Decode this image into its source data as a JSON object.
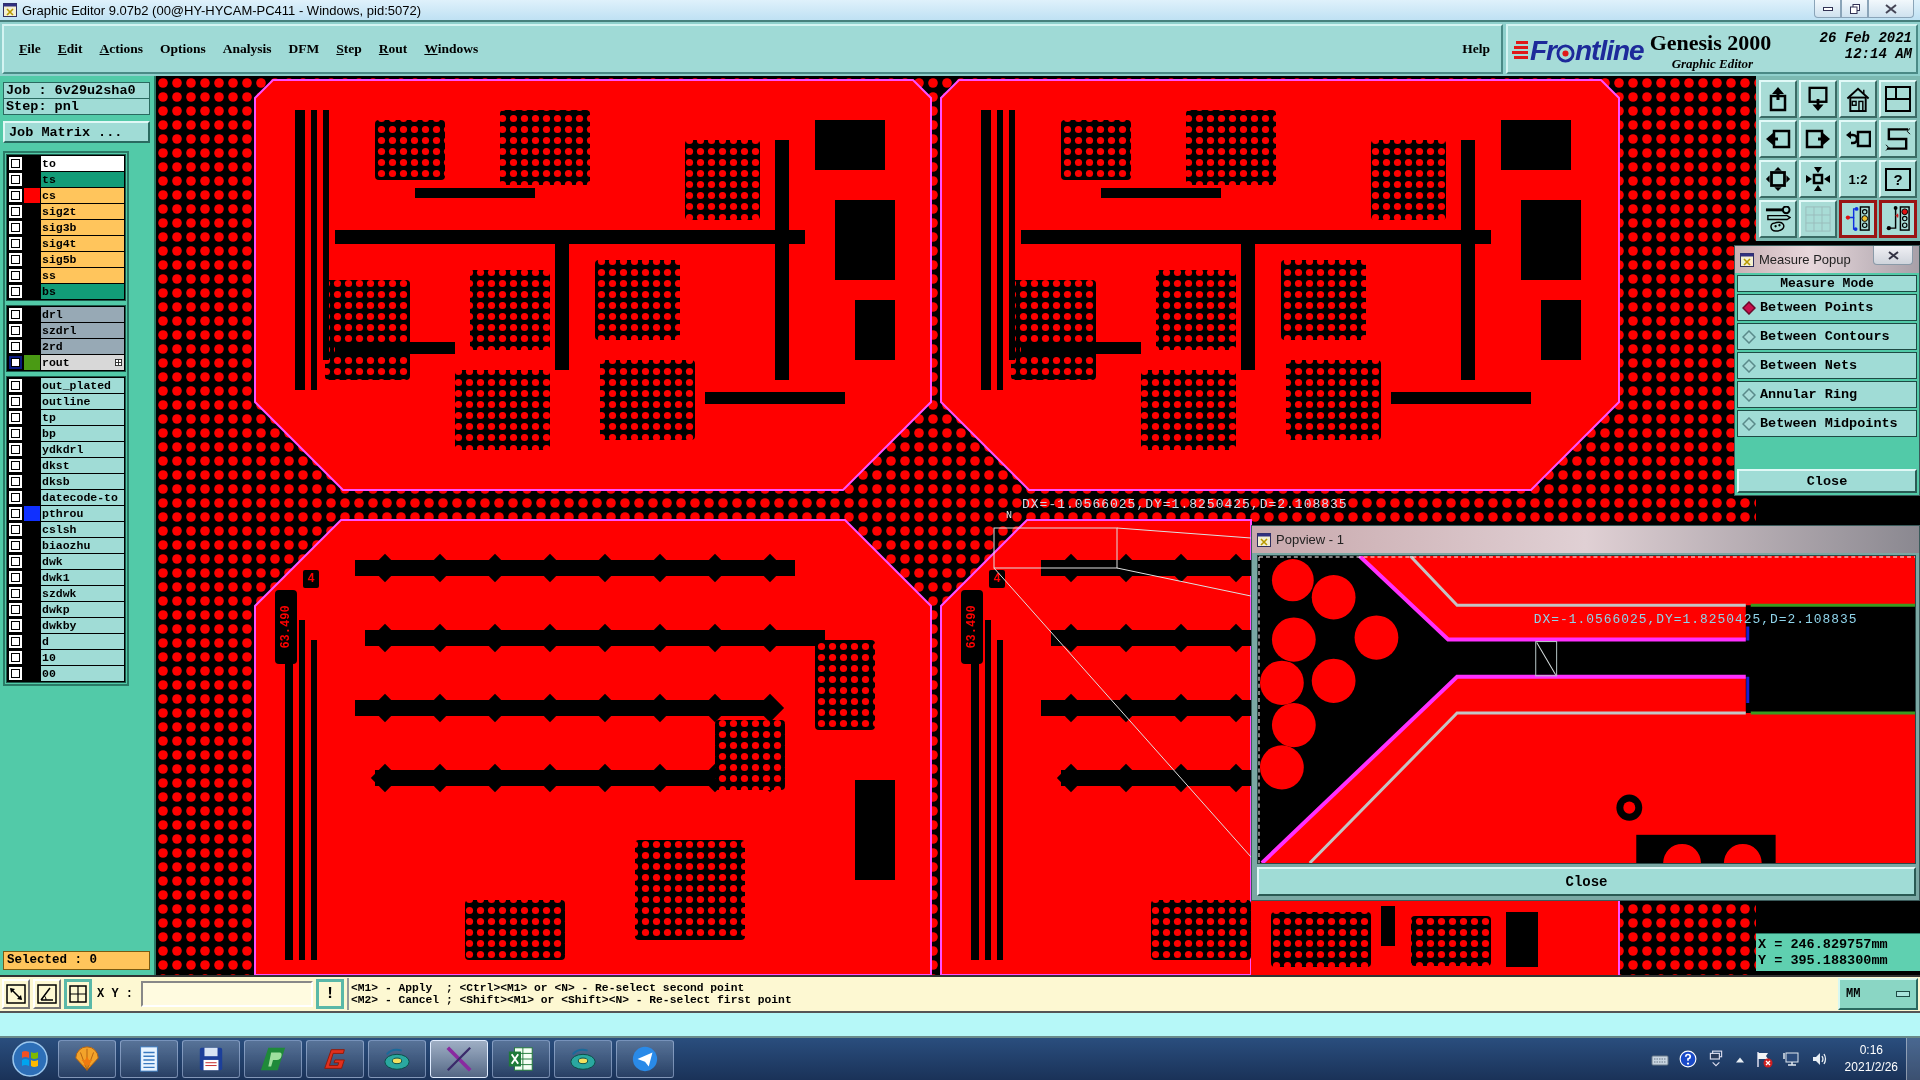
{
  "window": {
    "title": "Graphic Editor 9.07b2 (00@HY-HYCAM-PC411 - Windows, pid:5072)"
  },
  "menu": [
    {
      "label": "File",
      "mnemonic": true
    },
    {
      "label": "Edit",
      "mnemonic": true
    },
    {
      "label": "Actions",
      "mnemonic": true
    },
    {
      "label": "Options",
      "mnemonic": false
    },
    {
      "label": "Analysis",
      "mnemonic": false
    },
    {
      "label": "DFM",
      "mnemonic": false
    },
    {
      "label": "Step",
      "mnemonic": true
    },
    {
      "label": "Rout",
      "mnemonic": true
    },
    {
      "label": "Windows",
      "mnemonic": true
    }
  ],
  "help_menu": {
    "label": "Help",
    "mnemonic": false
  },
  "brand": {
    "logo_parts": [
      "Fr",
      "ntline"
    ],
    "product": "Genesis 2000",
    "subtitle": "Graphic Editor",
    "date": "26 Feb 2021",
    "time": "12:14 AM"
  },
  "job_panel": {
    "job": "Job : 6v29u2sha0",
    "step": "Step: pnl",
    "matrix_button": "Job Matrix ...",
    "selected_count": "Selected : 0"
  },
  "layer_groups": [
    {
      "layers": [
        {
          "name": "to",
          "kind": "silk",
          "checked": false,
          "selected": false
        },
        {
          "name": "ts",
          "kind": "mask",
          "checked": false,
          "selected": false
        },
        {
          "name": "cs",
          "kind": "signal",
          "checked": false,
          "selected": false,
          "color": "#ff0000"
        },
        {
          "name": "sig2t",
          "kind": "signal",
          "checked": false,
          "selected": false
        },
        {
          "name": "sig3b",
          "kind": "signal",
          "checked": false,
          "selected": false
        },
        {
          "name": "sig4t",
          "kind": "signal",
          "checked": false,
          "selected": false
        },
        {
          "name": "sig5b",
          "kind": "signal",
          "checked": false,
          "selected": false
        },
        {
          "name": "ss",
          "kind": "signal",
          "checked": false,
          "selected": false
        },
        {
          "name": "bs",
          "kind": "mask",
          "checked": false,
          "selected": false
        }
      ]
    },
    {
      "layers": [
        {
          "name": "drl",
          "kind": "drill",
          "checked": false,
          "selected": false
        },
        {
          "name": "szdrl",
          "kind": "drill",
          "checked": false,
          "selected": false
        },
        {
          "name": "2rd",
          "kind": "drill",
          "checked": false,
          "selected": false
        },
        {
          "name": "rout",
          "kind": "rout",
          "checked": false,
          "selected": true,
          "color": "#4a9a14"
        }
      ]
    },
    {
      "layers": [
        {
          "name": "out_plated",
          "kind": "misc",
          "checked": false,
          "selected": false
        },
        {
          "name": "outline",
          "kind": "misc",
          "checked": false,
          "selected": false
        },
        {
          "name": "tp",
          "kind": "misc",
          "checked": false,
          "selected": false
        },
        {
          "name": "bp",
          "kind": "misc",
          "checked": false,
          "selected": false
        },
        {
          "name": "ydkdrl",
          "kind": "misc",
          "checked": false,
          "selected": false
        },
        {
          "name": "dkst",
          "kind": "misc",
          "checked": false,
          "selected": false
        },
        {
          "name": "dksb",
          "kind": "misc",
          "checked": false,
          "selected": false
        },
        {
          "name": "datecode-to",
          "kind": "misc",
          "checked": false,
          "selected": false
        },
        {
          "name": "pthrou",
          "kind": "misc",
          "checked": false,
          "selected": false,
          "color": "#1030ff"
        },
        {
          "name": "cslsh",
          "kind": "misc",
          "checked": false,
          "selected": false
        },
        {
          "name": "biaozhu",
          "kind": "misc",
          "checked": false,
          "selected": false
        },
        {
          "name": "dwk",
          "kind": "misc",
          "checked": false,
          "selected": false
        },
        {
          "name": "dwk1",
          "kind": "misc",
          "checked": false,
          "selected": false
        },
        {
          "name": "szdwk",
          "kind": "misc",
          "checked": false,
          "selected": false
        },
        {
          "name": "dwkp",
          "kind": "misc",
          "checked": false,
          "selected": false
        },
        {
          "name": "dwkby",
          "kind": "misc",
          "checked": false,
          "selected": false
        },
        {
          "name": "d",
          "kind": "misc",
          "checked": false,
          "selected": false
        },
        {
          "name": "10",
          "kind": "misc",
          "checked": false,
          "selected": false
        },
        {
          "name": "00",
          "kind": "misc",
          "checked": false,
          "selected": false
        }
      ]
    }
  ],
  "canvas": {
    "measurement": "DX=-1.0566025,DY=1.8250425,D=2.108835",
    "marker": "N",
    "board_labels": [
      {
        "value": "63.490",
        "tag": "4"
      },
      {
        "value": "63.490",
        "tag": "4"
      }
    ]
  },
  "toolbar": [
    {
      "kind": "pan-up",
      "active": false
    },
    {
      "kind": "pan-down",
      "active": false
    },
    {
      "kind": "home",
      "active": false
    },
    {
      "kind": "layout",
      "active": false
    },
    {
      "kind": "pan-left",
      "active": false
    },
    {
      "kind": "pan-right",
      "active": false
    },
    {
      "kind": "undo",
      "active": false
    },
    {
      "kind": "route",
      "active": false
    },
    {
      "kind": "zoom-out",
      "active": false
    },
    {
      "kind": "zoom-in",
      "active": false
    },
    {
      "kind": "text",
      "label": "1:2",
      "active": false
    },
    {
      "kind": "framed-text",
      "label": "?",
      "active": false
    },
    {
      "kind": "tools",
      "active": false
    },
    {
      "kind": "grid",
      "active": false
    },
    {
      "kind": "circuit",
      "active": true
    },
    {
      "kind": "circuit-alt",
      "active": true
    }
  ],
  "measure_popup": {
    "title": "Measure Popup",
    "header": "Measure Mode",
    "options": [
      {
        "label": "Between Points",
        "selected": true
      },
      {
        "label": "Between Contours",
        "selected": false
      },
      {
        "label": "Between Nets",
        "selected": false
      },
      {
        "label": "Annular Ring",
        "selected": false
      },
      {
        "label": "Between Midpoints",
        "selected": false
      }
    ],
    "close": "Close"
  },
  "popview": {
    "title": "Popview - 1",
    "measurement": "DX=-1.0566025,DY=1.8250425,D=2.108835",
    "close": "Close"
  },
  "coordinates": [
    "X = 246.829757mm",
    "Y = 395.188300mm"
  ],
  "command_bar": {
    "tools": [
      {
        "kind": "diagonal",
        "active": false
      },
      {
        "kind": "angle",
        "active": false
      },
      {
        "kind": "grid",
        "active": true
      }
    ],
    "xy_label": "X Y :",
    "alert_button": "!",
    "messages": [
      "<M1> - Apply  ; <Ctrl><M1> or <N> - Re-select second point",
      "<M2> - Cancel ; <Shift><M1> or <Shift><N> - Re-select first point"
    ],
    "units": "MM"
  },
  "taskbar": {
    "apps": [
      {
        "kind": "shell",
        "selected": false
      },
      {
        "kind": "notepad",
        "selected": false
      },
      {
        "kind": "floppy",
        "selected": false
      },
      {
        "kind": "slanted",
        "selected": false
      },
      {
        "kind": "hook",
        "selected": false
      },
      {
        "kind": "disc",
        "selected": false
      },
      {
        "kind": "cross",
        "selected": true
      },
      {
        "kind": "spreadsheet",
        "selected": false
      },
      {
        "kind": "disc",
        "selected": false
      },
      {
        "kind": "plane",
        "selected": false
      }
    ],
    "time": "0:16",
    "date": "2021/2/26"
  }
}
